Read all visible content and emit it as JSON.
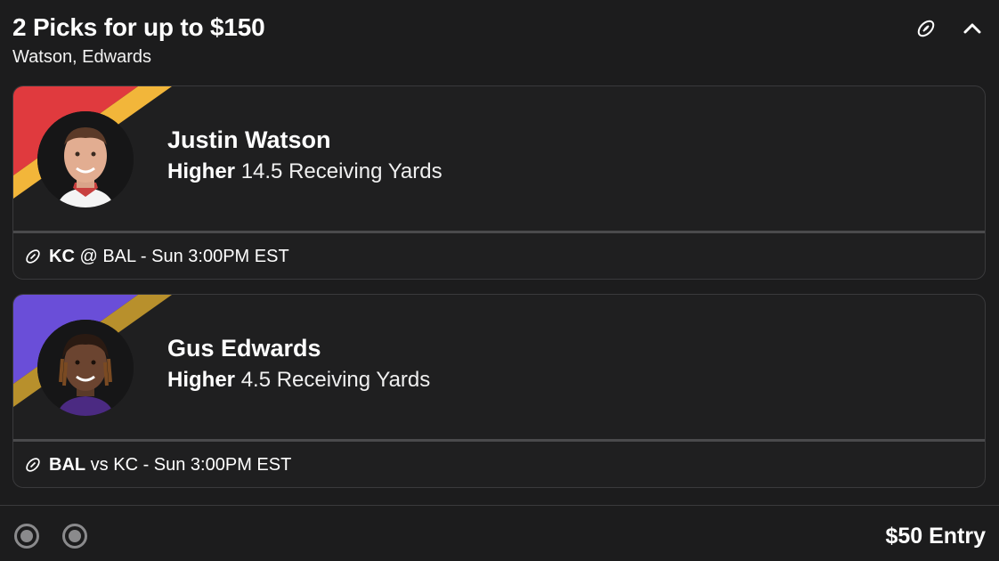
{
  "header": {
    "title": "2 Picks for up to $150",
    "subtitle": "Watson, Edwards",
    "icons": [
      "football-icon",
      "chevron-up-icon"
    ]
  },
  "picks": [
    {
      "player": "Justin Watson",
      "direction": "Higher",
      "line": "14.5 Receiving Yards",
      "team": "KC",
      "matchup": "@ BAL - Sun 3:00PM EST",
      "stripe_colors": [
        "#e03a3e",
        "#f2b63a"
      ]
    },
    {
      "player": "Gus Edwards",
      "direction": "Higher",
      "line": "4.5 Receiving Yards",
      "team": "BAL",
      "matchup": "vs KC - Sun 3:00PM EST",
      "stripe_colors": [
        "#6a4ed8",
        "#b8902c"
      ]
    }
  ],
  "footer": {
    "entry": "$50 Entry",
    "indicator_count": 2
  },
  "colors": {
    "background": "#1c1c1d",
    "card": "#1f1f20",
    "border": "#3a3a3c",
    "muted": "#8a8a8c"
  }
}
